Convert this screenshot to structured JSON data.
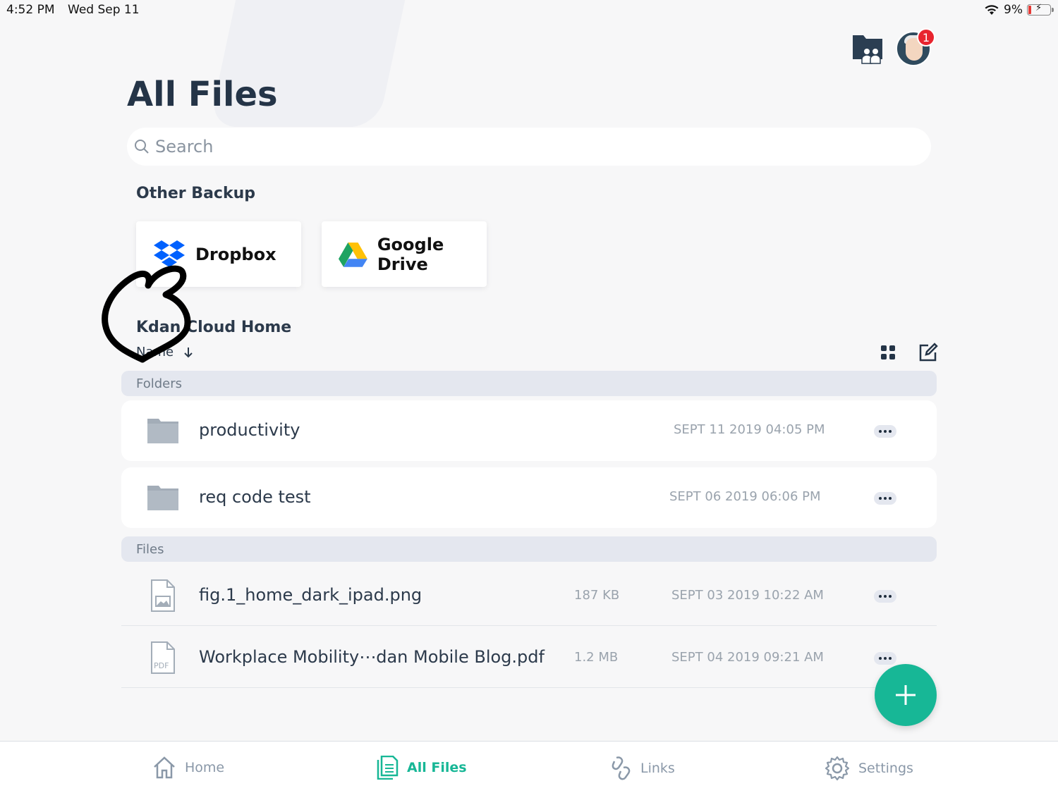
{
  "status_bar": {
    "time": "4:52 PM",
    "date": "Wed Sep 11",
    "battery": "9%"
  },
  "header": {
    "notification_count": "1"
  },
  "title": "All Files",
  "search": {
    "placeholder": "Search"
  },
  "other_backup": {
    "heading": "Other Backup",
    "services": [
      {
        "label": "Dropbox",
        "icon": "dropbox-icon"
      },
      {
        "label": "Google Drive",
        "icon": "google-drive-icon"
      }
    ]
  },
  "cloud_home": {
    "heading": "Kdan Cloud Home",
    "sort_label": "Name",
    "sort_direction_icon": "arrow-down-icon"
  },
  "folders": {
    "header": "Folders",
    "items": [
      {
        "name": "productivity",
        "date": "SEPT 11 2019 04:05 PM"
      },
      {
        "name": "req code test",
        "date": "SEPT 06 2019 06:06 PM"
      }
    ]
  },
  "files": {
    "header": "Files",
    "items": [
      {
        "name": "fig.1_home_dark_ipad.png",
        "size": "187 KB",
        "date": "SEPT 03 2019 10:22 AM",
        "icon": "image-file-icon"
      },
      {
        "name": "Workplace Mobility⋯dan Mobile Blog.pdf",
        "size": "1.2 MB",
        "date": "SEPT 04 2019 09:21 AM",
        "icon": "pdf-file-icon"
      }
    ]
  },
  "tabs": [
    {
      "label": "Home",
      "icon": "home-icon",
      "active": false
    },
    {
      "label": "All Files",
      "icon": "files-icon",
      "active": true
    },
    {
      "label": "Links",
      "icon": "links-icon",
      "active": false
    },
    {
      "label": "Settings",
      "icon": "gear-icon",
      "active": false
    }
  ],
  "colors": {
    "accent": "#17b796",
    "title": "#243447",
    "group_header": "#e4e7ef",
    "badge": "#e8242e"
  }
}
